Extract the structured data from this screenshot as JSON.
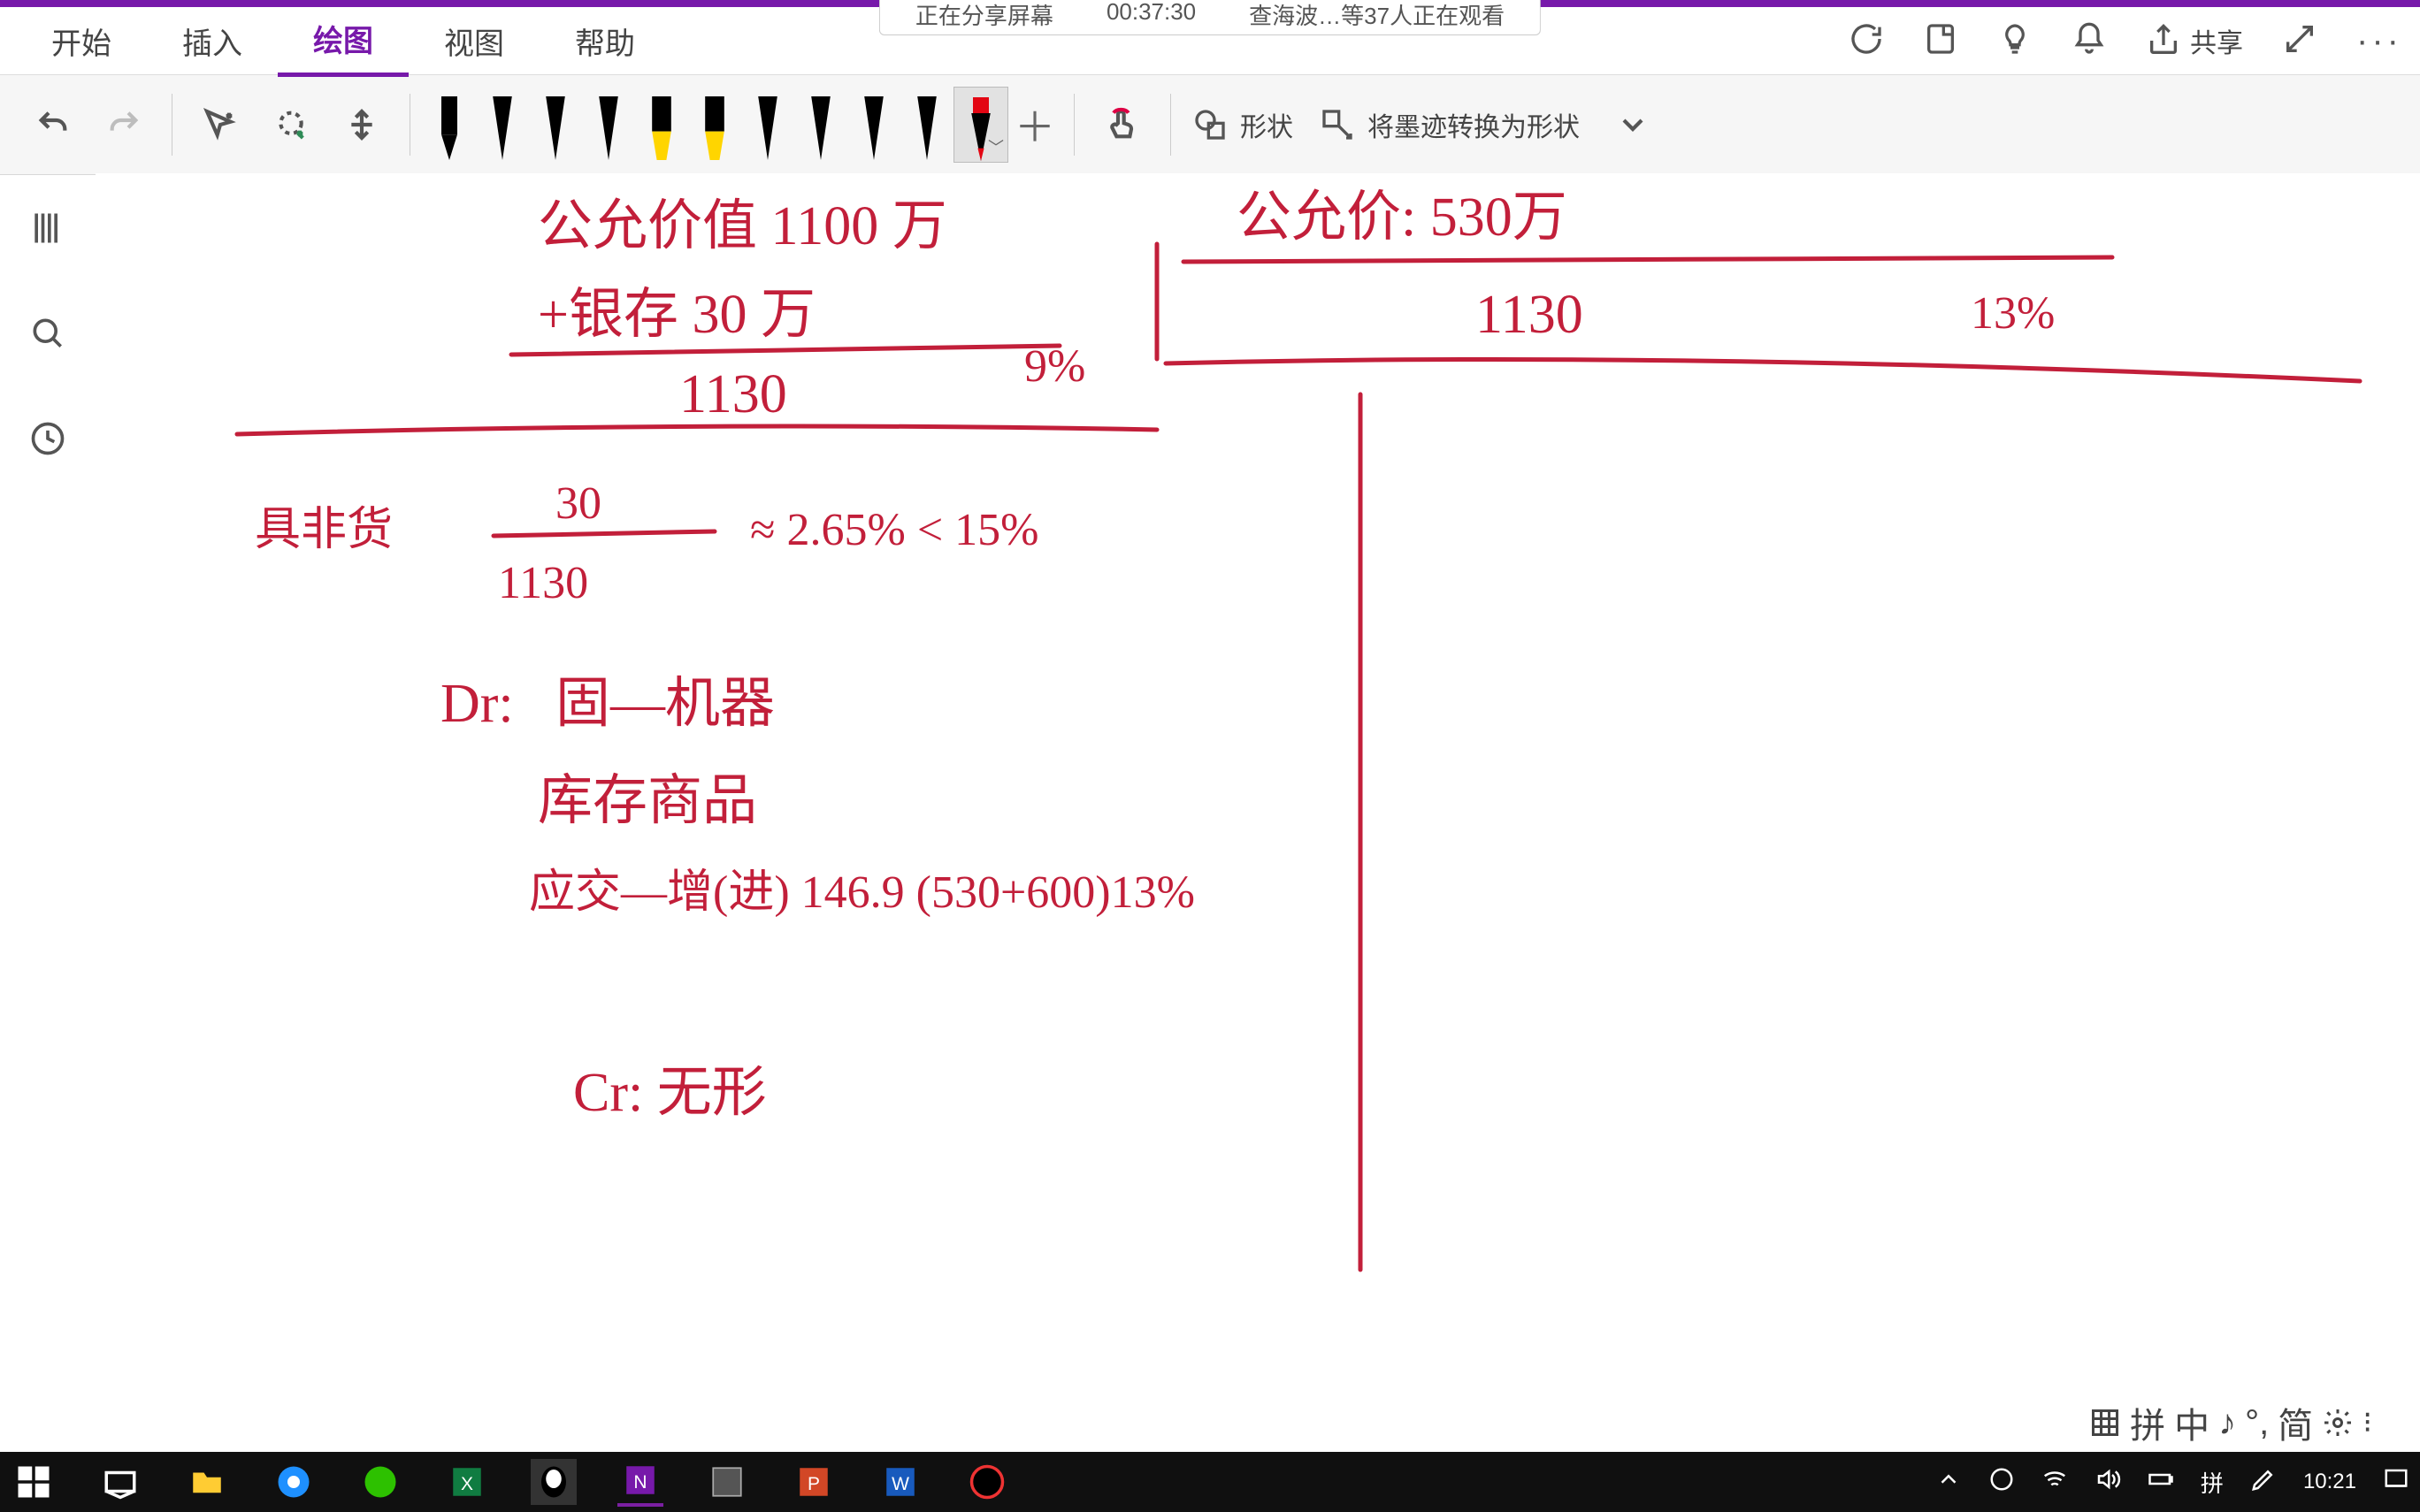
{
  "floatbar": {
    "left": "正在分享屏幕",
    "time": "00:37:30",
    "right": "查海波…等37人正在观看"
  },
  "tabs": [
    "开始",
    "插入",
    "绘图",
    "视图",
    "帮助"
  ],
  "active_tab": 2,
  "share_label": "共享",
  "ribbon": {
    "shapes_label": "形状",
    "ink2shape_label": "将墨迹转换为形状",
    "pen_colors": [
      "#000",
      "#000",
      "#000",
      "#000",
      "#ffd500",
      "#ffd500",
      "#000",
      "#000",
      "#000",
      "#000",
      "#e30613"
    ],
    "selected_pen": 10
  },
  "handwriting": {
    "line1_left": "公允价值  1100 万",
    "line1_right": "公允价: 530万",
    "line2_left": "+银存   30 万",
    "sum_left": "1130",
    "pct_left": "9%",
    "sum_right": "1130",
    "pct_right": "13%",
    "frac_label": "具非货",
    "frac_num": "30",
    "frac_den": "1130",
    "frac_eq": "≈ 2.65%  < 15%",
    "dr": "Dr:",
    "dr1": "固—机器",
    "dr2": "库存商品",
    "dr3": "应交—增(进)   146.9    (530+600)13%",
    "cr": "Cr: 无形"
  },
  "ime": {
    "items": [
      "拼",
      "中",
      "♪",
      "°,",
      "简"
    ]
  },
  "clock": {
    "time": "10:21"
  }
}
